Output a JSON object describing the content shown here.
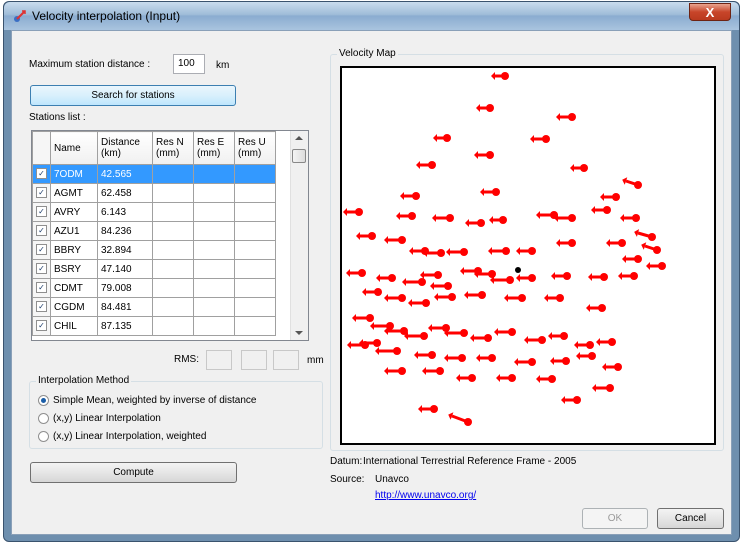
{
  "window": {
    "title": "Velocity interpolation (Input)",
    "close_glyph": "X"
  },
  "max_distance": {
    "label": "Maximum station distance :",
    "value": "100",
    "unit": "km"
  },
  "search_button": "Search for stations",
  "stations_label": "Stations list :",
  "table": {
    "headers": [
      "Name",
      "Distance\n(km)",
      "Res N\n(mm)",
      "Res E\n(mm)",
      "Res U\n(mm)"
    ],
    "rows": [
      {
        "name": "7ODM",
        "distance": "42.565",
        "checked": true,
        "selected": true
      },
      {
        "name": "AGMT",
        "distance": "62.458",
        "checked": true,
        "selected": false
      },
      {
        "name": "AVRY",
        "distance": "6.143",
        "checked": true,
        "selected": false
      },
      {
        "name": "AZU1",
        "distance": "84.236",
        "checked": true,
        "selected": false
      },
      {
        "name": "BBRY",
        "distance": "32.894",
        "checked": true,
        "selected": false
      },
      {
        "name": "BSRY",
        "distance": "47.140",
        "checked": true,
        "selected": false
      },
      {
        "name": "CDMT",
        "distance": "79.008",
        "checked": true,
        "selected": false
      },
      {
        "name": "CGDM",
        "distance": "84.481",
        "checked": true,
        "selected": false
      },
      {
        "name": "CHIL",
        "distance": "87.135",
        "checked": true,
        "selected": false
      }
    ]
  },
  "rms": {
    "label": "RMS:",
    "unit": "mm"
  },
  "interpolation": {
    "title": "Interpolation Method",
    "options": [
      {
        "label": "Simple Mean, weighted by inverse of distance",
        "selected": true
      },
      {
        "label": "(x,y) Linear Interpolation",
        "selected": false
      },
      {
        "label": "(x,y) Linear Interpolation, weighted",
        "selected": false
      }
    ]
  },
  "compute_button": "Compute",
  "velocity_map": {
    "title": "Velocity Map"
  },
  "datum": {
    "label": "Datum:",
    "value": "International Terrestrial Reference Frame - 2005"
  },
  "source": {
    "label": "Source:",
    "value": "Unavco",
    "url": "http://www.unavco.org/"
  },
  "ok_button": "OK",
  "cancel_button": "Cancel",
  "colors": {
    "arrow": "#ff0000",
    "selection": "#3399ff"
  }
}
